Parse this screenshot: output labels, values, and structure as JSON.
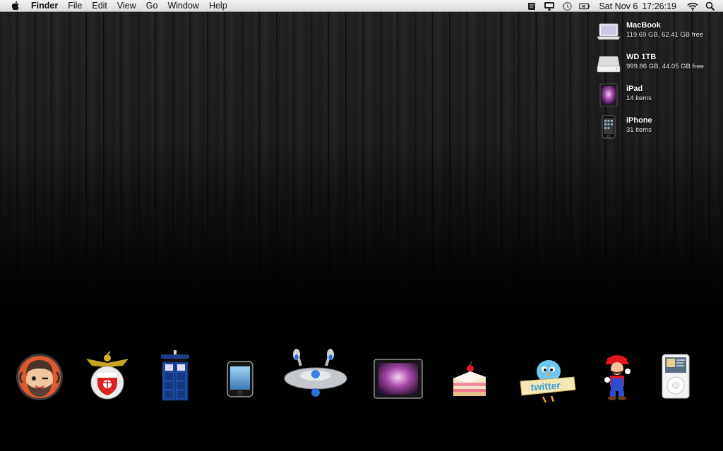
{
  "menubar": {
    "apple_icon": "apple-logo-icon",
    "app_name": "Finder",
    "menus": [
      "File",
      "Edit",
      "View",
      "Go",
      "Window",
      "Help"
    ],
    "status_icons": [
      "script-icon",
      "display-icon",
      "time-machine-icon",
      "battery-icon",
      "wifi-icon",
      "spotlight-icon"
    ],
    "clock_day": "Sat Nov 6",
    "clock_time": "17:26:19"
  },
  "desktop_volumes": [
    {
      "name": "MacBook",
      "info": "119.69 GB, 62.41 GB free",
      "icon": "macbook-icon"
    },
    {
      "name": "WD 1TB",
      "info": "999.86 GB, 44.05 GB free",
      "icon": "external-drive-icon"
    },
    {
      "name": "iPad",
      "info": "14 items",
      "icon": "ipad-icon"
    },
    {
      "name": "iPhone",
      "info": "31 items",
      "icon": "iphone-icon"
    }
  ],
  "desktop_icons": [
    "avatar-face-icon",
    "benfica-crest-icon",
    "tardis-icon",
    "iphone-app-icon",
    "starship-icon",
    "ipad-app-icon",
    "cake-icon",
    "twitter-bird-icon",
    "mario-icon",
    "ipod-icon"
  ],
  "colors": {
    "menubar": "#e6e6e6",
    "wallpaper_wood": "#222222",
    "text_on_desktop": "#ffffff"
  }
}
